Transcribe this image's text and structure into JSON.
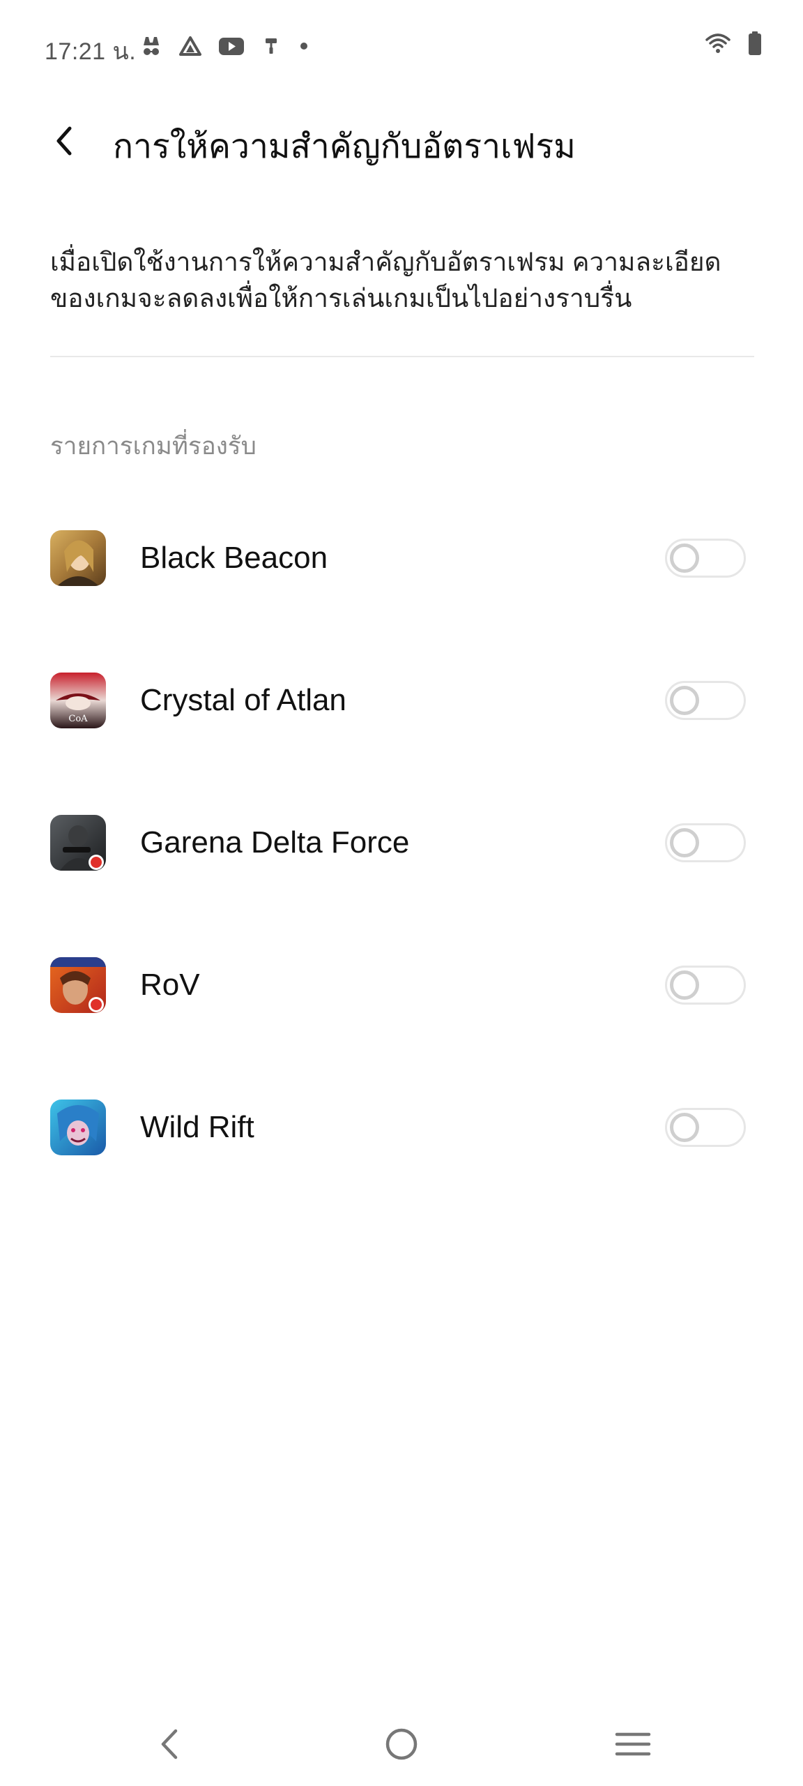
{
  "status_bar": {
    "time": "17:21 น.",
    "notification_icons": [
      "incognito-icon",
      "drive-icon",
      "youtube-icon",
      "paint-roller-icon",
      "dot-icon"
    ],
    "wifi_icon": "wifi-icon",
    "battery_icon": "battery-icon"
  },
  "header": {
    "back_icon": "chevron-left-icon",
    "title": "การให้ความสำคัญกับอัตราเฟรม"
  },
  "description": {
    "line1": "เมื่อเปิดใช้งานการให้ความสำคัญกับอัตราเฟรม ความละเอียด",
    "line2": "ของเกมจะลดลงเพื่อให้การเล่นเกมเป็นไปอย่างราบรื่น"
  },
  "section": {
    "title": "รายการเกมที่รองรับ"
  },
  "games": [
    {
      "name": "Black Beacon",
      "icon": "black-beacon-app-icon",
      "enabled": false
    },
    {
      "name": "Crystal of Atlan",
      "icon": "crystal-of-atlan-app-icon",
      "enabled": false
    },
    {
      "name": "Garena Delta Force",
      "icon": "garena-delta-force-app-icon",
      "enabled": false
    },
    {
      "name": "RoV",
      "icon": "rov-app-icon",
      "enabled": false
    },
    {
      "name": "Wild Rift",
      "icon": "wild-rift-app-icon",
      "enabled": false
    }
  ],
  "nav_bar": {
    "back": "nav-back-icon",
    "home": "nav-home-icon",
    "recents": "nav-menu-icon"
  },
  "colors": {
    "background": "#ffffff",
    "text_primary": "#111111",
    "text_secondary": "#8a8a8a",
    "toggle_off_track": "#e6e6e6",
    "toggle_off_knob": "#cfcfcf"
  }
}
